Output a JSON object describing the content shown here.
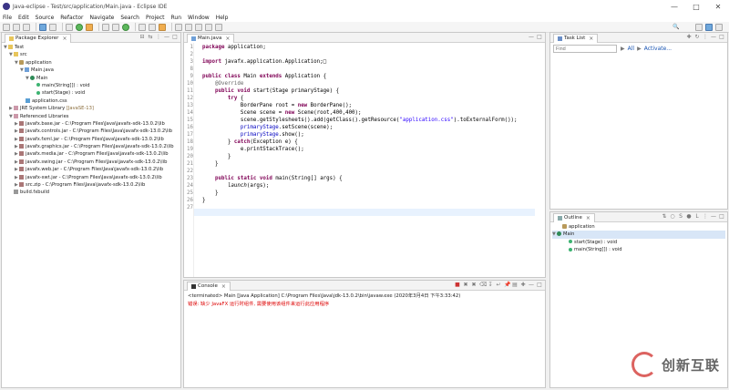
{
  "window": {
    "title": "Java-eclipse - Test/src/application/Main.java - Eclipse IDE"
  },
  "menu": [
    "File",
    "Edit",
    "Source",
    "Refactor",
    "Navigate",
    "Search",
    "Project",
    "Run",
    "Window",
    "Help"
  ],
  "package_explorer": {
    "tab": "Package Explorer",
    "items": [
      "Test",
      "src",
      "application",
      "Main.java",
      "Main",
      "main(String[]) : void",
      "start(Stage) : void",
      "application.css",
      "JRE System Library",
      "[JavaSE-13]",
      "Referenced Libraries",
      "javafx.base.jar - C:\\Program Files\\Java\\javafx-sdk-13.0.2\\lib",
      "javafx.controls.jar - C:\\Program Files\\Java\\javafx-sdk-13.0.2\\lib",
      "javafx.fxml.jar - C:\\Program Files\\Java\\javafx-sdk-13.0.2\\lib",
      "javafx.graphics.jar - C:\\Program Files\\Java\\javafx-sdk-13.0.2\\lib",
      "javafx.media.jar - C:\\Program Files\\Java\\javafx-sdk-13.0.2\\lib",
      "javafx.swing.jar - C:\\Program Files\\Java\\javafx-sdk-13.0.2\\lib",
      "javafx.web.jar - C:\\Program Files\\Java\\javafx-sdk-13.0.2\\lib",
      "javafx-swt.jar - C:\\Program Files\\Java\\javafx-sdk-13.0.2\\lib",
      "src.zip - C:\\Program Files\\Java\\javafx-sdk-13.0.2\\lib",
      "build.fxbuild"
    ]
  },
  "editor": {
    "tab": "Main.java",
    "line_numbers": [
      "1",
      "2",
      "3",
      "8",
      "9",
      "10",
      "11",
      "12",
      "13",
      "14",
      "15",
      "16",
      "17",
      "18",
      "19",
      "20",
      "21",
      "22",
      "23",
      "24",
      "25",
      "26",
      "27"
    ]
  },
  "console": {
    "tab": "Console",
    "terminated": "<terminated> Main [Java Application] C:\\Program Files\\Java\\jdk-13.0.2\\bin\\javaw.exe (2020年3月4日 下午3:33:42)",
    "error": "错误: 缺少 JavaFX 运行时组件, 需要使用该组件来运行此应用程序"
  },
  "task_list": {
    "tab": "Task List",
    "find_placeholder": "Find",
    "all": "All",
    "activate": "Activate..."
  },
  "outline": {
    "tab": "Outline",
    "items": [
      "application",
      "Main",
      "start(Stage) : void",
      "main(String[]) : void"
    ]
  },
  "watermark": {
    "text": "创新互联"
  }
}
